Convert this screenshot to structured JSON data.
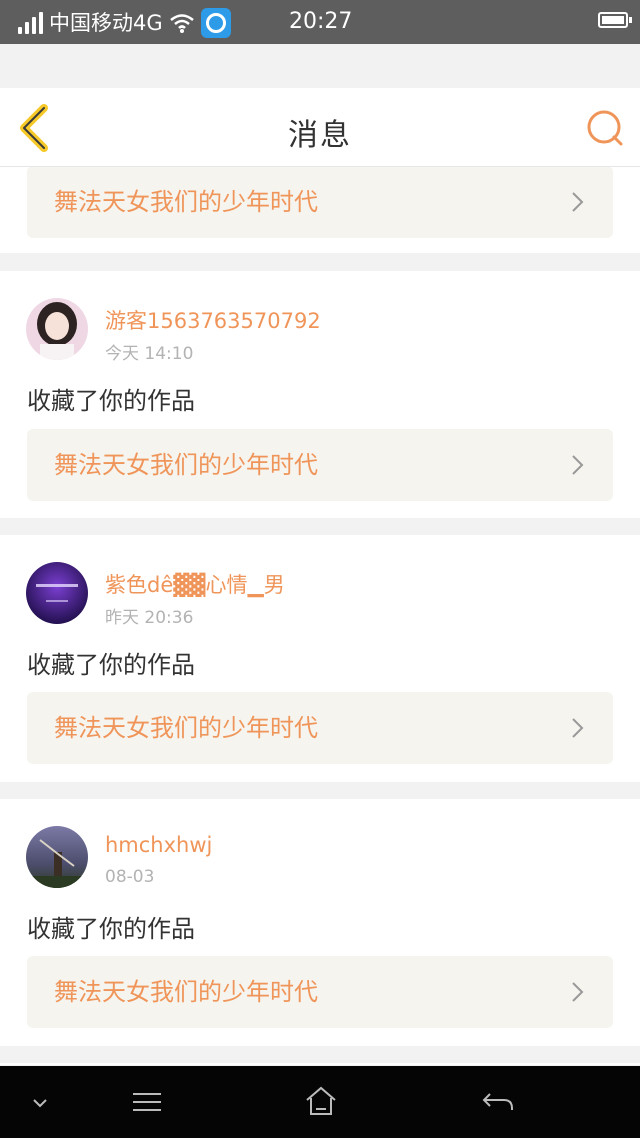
{
  "status_bar": {
    "carrier": "中国移动4G",
    "time": "20:27"
  },
  "header": {
    "title": "消息",
    "back_icon": "chevron-left-icon",
    "search_icon": "search-icon"
  },
  "feed": [
    {
      "work_title": "舞法天女我们的少年时代"
    },
    {
      "username": "游客1563763570792",
      "time": "今天 14:10",
      "action": "收藏了你的作品",
      "work_title": "舞法天女我们的少年时代",
      "avatar_colors": [
        "#f0d9e6",
        "#3b2a2a"
      ]
    },
    {
      "username": "紫色dê▓▓心情▁男",
      "time": "昨天 20:36",
      "action": "收藏了你的作品",
      "work_title": "舞法天女我们的少年时代",
      "avatar_colors": [
        "#6a2bb8",
        "#2a0f5c"
      ]
    },
    {
      "username": "hmchxhwj",
      "time": "08-03",
      "action": "收藏了你的作品",
      "work_title": "舞法天女我们的少年时代",
      "avatar_colors": [
        "#6b6a8a",
        "#2b3a2a"
      ]
    }
  ],
  "nav_bar": {
    "icons": [
      "chevron-down-icon",
      "menu-icon",
      "home-icon",
      "back-arrow-icon"
    ]
  },
  "colors": {
    "accent": "#f0955a",
    "work_row_bg": "#f5f4ee",
    "status_bar": "#5e5e5e"
  }
}
